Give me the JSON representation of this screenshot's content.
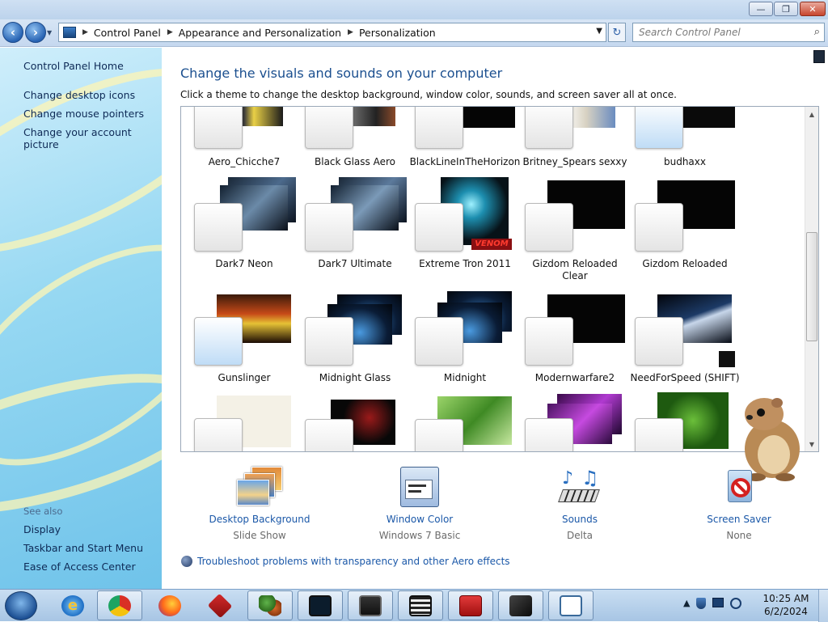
{
  "window": {
    "caption_buttons": {
      "minimize": "—",
      "maximize": "❐",
      "close": "✕"
    }
  },
  "address": {
    "crumbs": [
      "Control Panel",
      "Appearance and Personalization",
      "Personalization"
    ],
    "search_placeholder": "Search Control Panel"
  },
  "sidebar": {
    "home": "Control Panel Home",
    "links": [
      "Change desktop icons",
      "Change mouse pointers",
      "Change your account picture"
    ],
    "see_also_heading": "See also",
    "see_also": [
      "Display",
      "Taskbar and Start Menu",
      "Ease of Access Center"
    ]
  },
  "main": {
    "title": "Change the visuals and sounds on your computer",
    "hint": "Click a theme to change the desktop background, window color, sounds, and screen saver all at once."
  },
  "themes": {
    "row1": [
      "Aero_Chicche7",
      "Black Glass Aero",
      "BlackLineInTheHorizon",
      "Britney_Spears sexxy",
      "budhaxx"
    ],
    "row2": [
      "Dark7 Neon",
      "Dark7 Ultimate",
      "Extreme Tron 2011",
      "Gizdom Reloaded Clear",
      "Gizdom Reloaded"
    ],
    "row3": [
      "Gunslinger",
      "Midnight Glass",
      "Midnight",
      "Modernwarfare2",
      "NeedForSpeed (SHIFT)"
    ],
    "tron_logo_text": "VENOM"
  },
  "settings": {
    "desktop_background": {
      "label": "Desktop Background",
      "value": "Slide Show"
    },
    "window_color": {
      "label": "Window Color",
      "value": "Windows 7 Basic"
    },
    "sounds": {
      "label": "Sounds",
      "value": "Delta"
    },
    "screen_saver": {
      "label": "Screen Saver",
      "value": "None"
    }
  },
  "troubleshoot_link": "Troubleshoot problems with transparency and other Aero effects",
  "taskbar": {
    "time": "10:25 AM",
    "date": "6/2/2024",
    "tray_overflow": "▲"
  },
  "colors": {
    "link": "#1b58a8",
    "title": "#1b4f8f",
    "sidebar_bg": "#96d8f2"
  }
}
